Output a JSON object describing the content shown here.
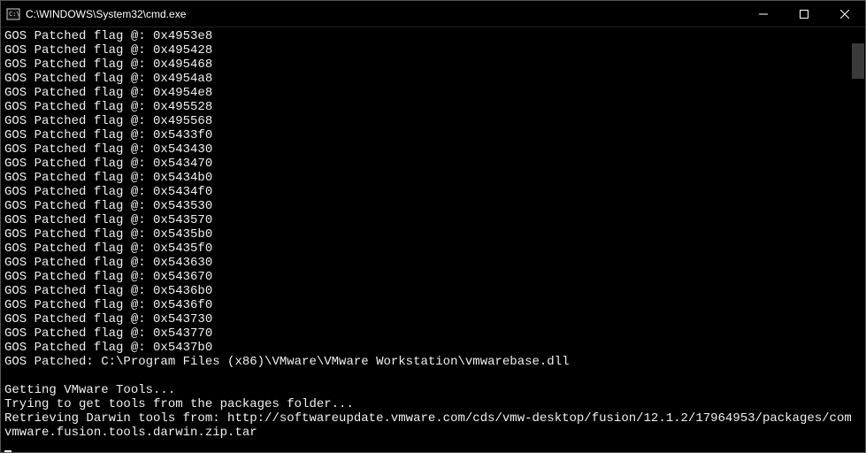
{
  "window": {
    "title": "C:\\WINDOWS\\System32\\cmd.exe"
  },
  "terminal": {
    "lines": [
      "GOS Patched flag @: 0x4953e8",
      "GOS Patched flag @: 0x495428",
      "GOS Patched flag @: 0x495468",
      "GOS Patched flag @: 0x4954a8",
      "GOS Patched flag @: 0x4954e8",
      "GOS Patched flag @: 0x495528",
      "GOS Patched flag @: 0x495568",
      "GOS Patched flag @: 0x5433f0",
      "GOS Patched flag @: 0x543430",
      "GOS Patched flag @: 0x543470",
      "GOS Patched flag @: 0x5434b0",
      "GOS Patched flag @: 0x5434f0",
      "GOS Patched flag @: 0x543530",
      "GOS Patched flag @: 0x543570",
      "GOS Patched flag @: 0x5435b0",
      "GOS Patched flag @: 0x5435f0",
      "GOS Patched flag @: 0x543630",
      "GOS Patched flag @: 0x543670",
      "GOS Patched flag @: 0x5436b0",
      "GOS Patched flag @: 0x5436f0",
      "GOS Patched flag @: 0x543730",
      "GOS Patched flag @: 0x543770",
      "GOS Patched flag @: 0x5437b0",
      "GOS Patched: C:\\Program Files (x86)\\VMware\\VMware Workstation\\vmwarebase.dll",
      "",
      "Getting VMware Tools...",
      "Trying to get tools from the packages folder...",
      "Retrieving Darwin tools from: http://softwareupdate.vmware.com/cds/vmw-desktop/fusion/12.1.2/17964953/packages/com.vmware.fusion.tools.darwin.zip.tar"
    ]
  }
}
